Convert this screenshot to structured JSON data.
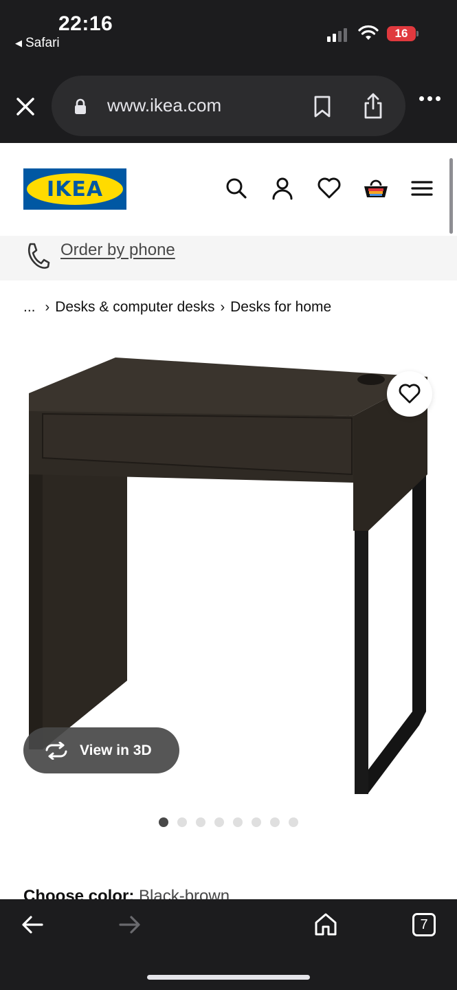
{
  "status_bar": {
    "time": "22:16",
    "back_app": "Safari",
    "battery": "16"
  },
  "browser": {
    "url": "www.ikea.com",
    "tabs_count": "7"
  },
  "header": {
    "logo_text": "IKEA"
  },
  "order_by_phone": {
    "label": "Order by phone"
  },
  "breadcrumb": {
    "ellipsis": "...",
    "items": [
      "Desks & computer desks",
      "Desks for home"
    ]
  },
  "product": {
    "view_3d_label": "View in 3D",
    "image_count": 8,
    "active_image_index": 0,
    "color_label": "Choose color:",
    "color_value": "Black-brown"
  },
  "icons": {
    "close": "close-icon",
    "lock": "lock-icon",
    "bookmark": "bookmark-icon",
    "share": "share-icon",
    "more": "more-icon",
    "search": "search-icon",
    "account": "user-icon",
    "favorites": "heart-icon",
    "cart": "cart-icon",
    "menu": "hamburger-menu-icon",
    "phone": "phone-icon",
    "rotate": "rotate-3d-icon",
    "back": "back-arrow-icon",
    "forward": "forward-arrow-icon",
    "home": "home-icon"
  },
  "colors": {
    "ikea_blue": "#0058a3",
    "ikea_yellow": "#ffdb00",
    "chrome_dark": "#1c1c1e",
    "battery_red": "#e0393e"
  }
}
